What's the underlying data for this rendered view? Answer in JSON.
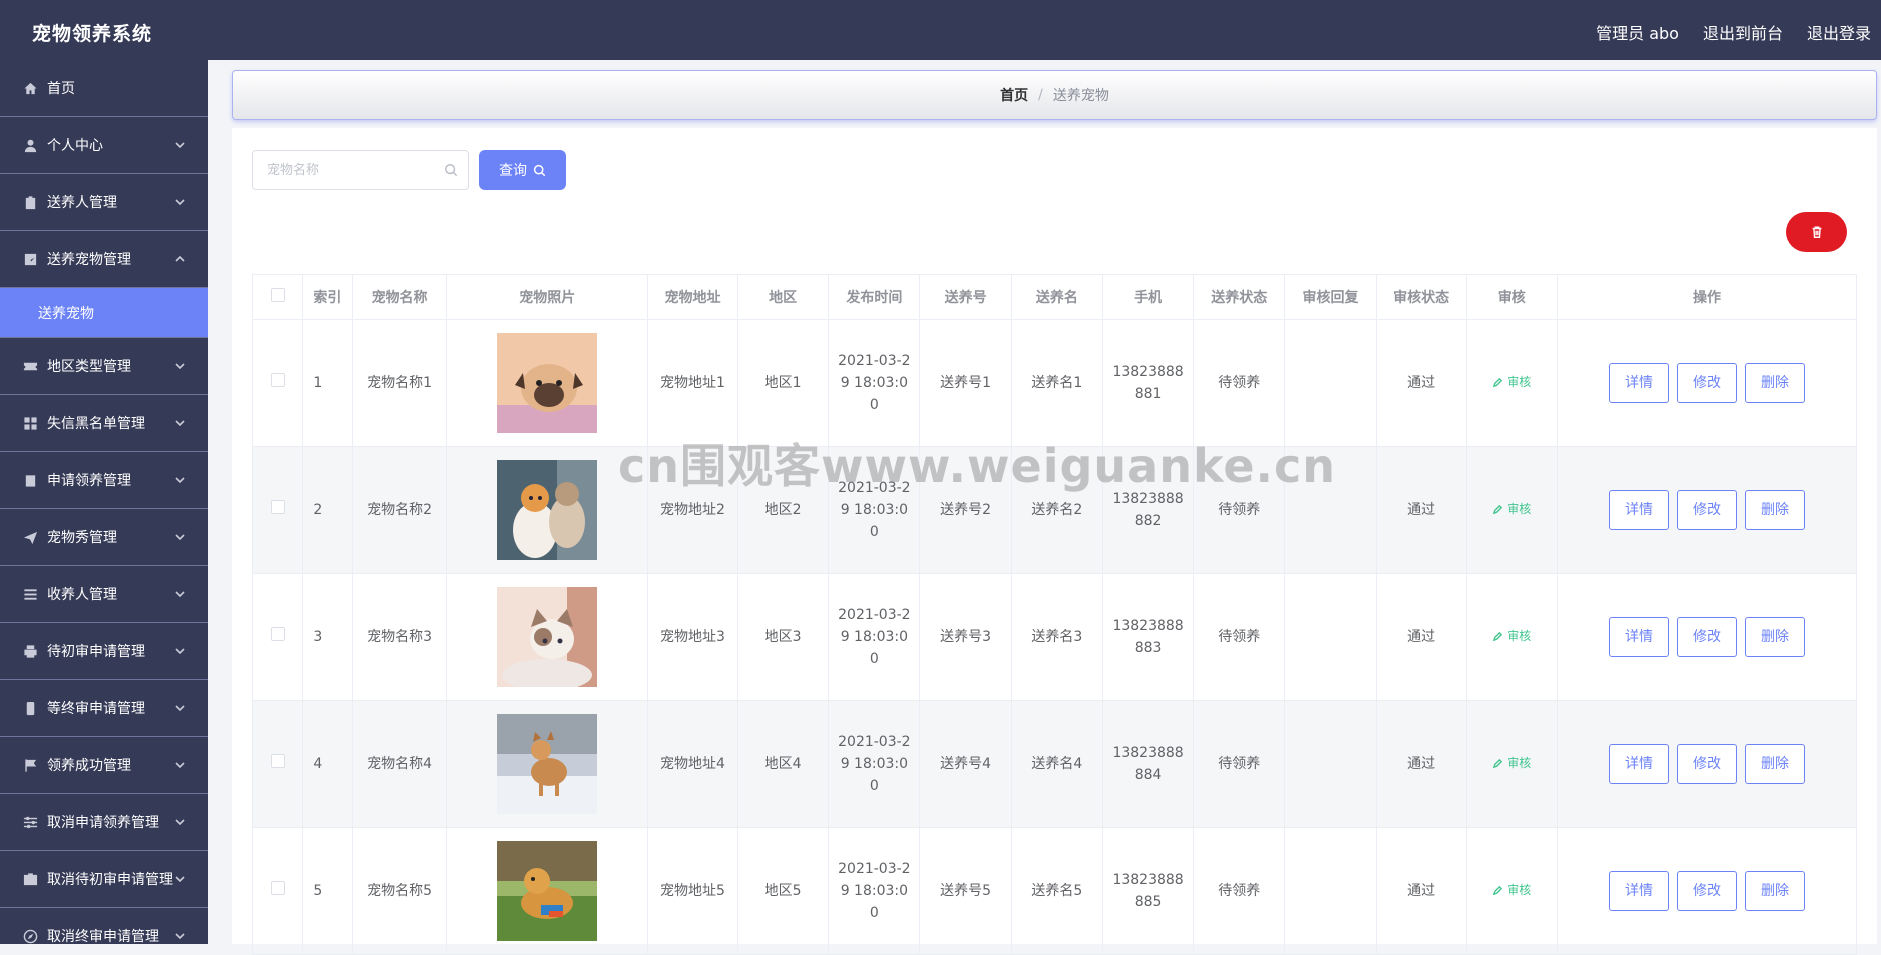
{
  "header": {
    "title": "宠物领养系统",
    "admin_label": "管理员 abo",
    "to_front_label": "退出到前台",
    "logout_label": "退出登录"
  },
  "sidebar": {
    "items": [
      {
        "label": "首页",
        "icon": "home-icon",
        "has_children": false
      },
      {
        "label": "个人中心",
        "icon": "user-icon",
        "has_children": true
      },
      {
        "label": "送养人管理",
        "icon": "clipboard-icon",
        "has_children": true
      },
      {
        "label": "送养宠物管理",
        "icon": "chart-icon",
        "has_children": true,
        "expanded": true
      },
      {
        "label": "地区类型管理",
        "icon": "ticket-icon",
        "has_children": true
      },
      {
        "label": "失信黑名单管理",
        "icon": "grid-icon",
        "has_children": true
      },
      {
        "label": "申请领养管理",
        "icon": "check-clipboard-icon",
        "has_children": true
      },
      {
        "label": "宠物秀管理",
        "icon": "send-icon",
        "has_children": true
      },
      {
        "label": "收养人管理",
        "icon": "list-icon",
        "has_children": true
      },
      {
        "label": "待初审申请管理",
        "icon": "printer-icon",
        "has_children": true
      },
      {
        "label": "等终审申请管理",
        "icon": "phone-icon",
        "has_children": true
      },
      {
        "label": "领养成功管理",
        "icon": "flag-icon",
        "has_children": true
      },
      {
        "label": "取消申请领养管理",
        "icon": "sliders-icon",
        "has_children": true
      },
      {
        "label": "取消待初审申请管理",
        "icon": "briefcase-icon",
        "has_children": true
      },
      {
        "label": "取消终审申请管理",
        "icon": "compass-icon",
        "has_children": true
      }
    ],
    "active_sub": "送养宠物"
  },
  "breadcrumb": {
    "home": "首页",
    "separator": "/",
    "current": "送养宠物"
  },
  "search": {
    "placeholder": "宠物名称",
    "value": "",
    "button_label": "查询"
  },
  "table": {
    "columns": [
      "",
      "索引",
      "宠物名称",
      "宠物照片",
      "宠物地址",
      "地区",
      "发布时间",
      "送养号",
      "送养名",
      "手机",
      "送养状态",
      "审核回复",
      "审核状态",
      "审核",
      "操作"
    ],
    "audit_link_label": "审核",
    "actions": [
      "详情",
      "修改",
      "删除"
    ],
    "rows": [
      {
        "index": "1",
        "name": "宠物名称1",
        "photo": "pug",
        "address": "宠物地址1",
        "region": "地区1",
        "time": "2021-03-29 18:03:00",
        "adopt_no": "送养号1",
        "adopt_name": "送养名1",
        "phone": "13823888881",
        "status": "待领养",
        "reply": "",
        "audit_status": "通过"
      },
      {
        "index": "2",
        "name": "宠物名称2",
        "photo": "cats",
        "address": "宠物地址2",
        "region": "地区2",
        "time": "2021-03-29 18:03:00",
        "adopt_no": "送养号2",
        "adopt_name": "送养名2",
        "phone": "13823888882",
        "status": "待领养",
        "reply": "",
        "audit_status": "通过"
      },
      {
        "index": "3",
        "name": "宠物名称3",
        "photo": "kitten",
        "address": "宠物地址3",
        "region": "地区3",
        "time": "2021-03-29 18:03:00",
        "adopt_no": "送养号3",
        "adopt_name": "送养名3",
        "phone": "13823888883",
        "status": "待领养",
        "reply": "",
        "audit_status": "通过"
      },
      {
        "index": "4",
        "name": "宠物名称4",
        "photo": "shiba",
        "address": "宠物地址4",
        "region": "地区4",
        "time": "2021-03-29 18:03:00",
        "adopt_no": "送养号4",
        "adopt_name": "送养名4",
        "phone": "13823888884",
        "status": "待领养",
        "reply": "",
        "audit_status": "通过"
      },
      {
        "index": "5",
        "name": "宠物名称5",
        "photo": "golden",
        "address": "宠物地址5",
        "region": "地区5",
        "time": "2021-03-29 18:03:00",
        "adopt_no": "送养号5",
        "adopt_name": "送养名5",
        "phone": "13823888885",
        "status": "待领养",
        "reply": "",
        "audit_status": "通过"
      }
    ]
  },
  "watermark": "cn围观客www.weiguanke.cn",
  "colors": {
    "header_bg": "#353a57",
    "accent": "#6c83f7",
    "danger": "#e01b24",
    "audit_green": "#42c58f"
  }
}
